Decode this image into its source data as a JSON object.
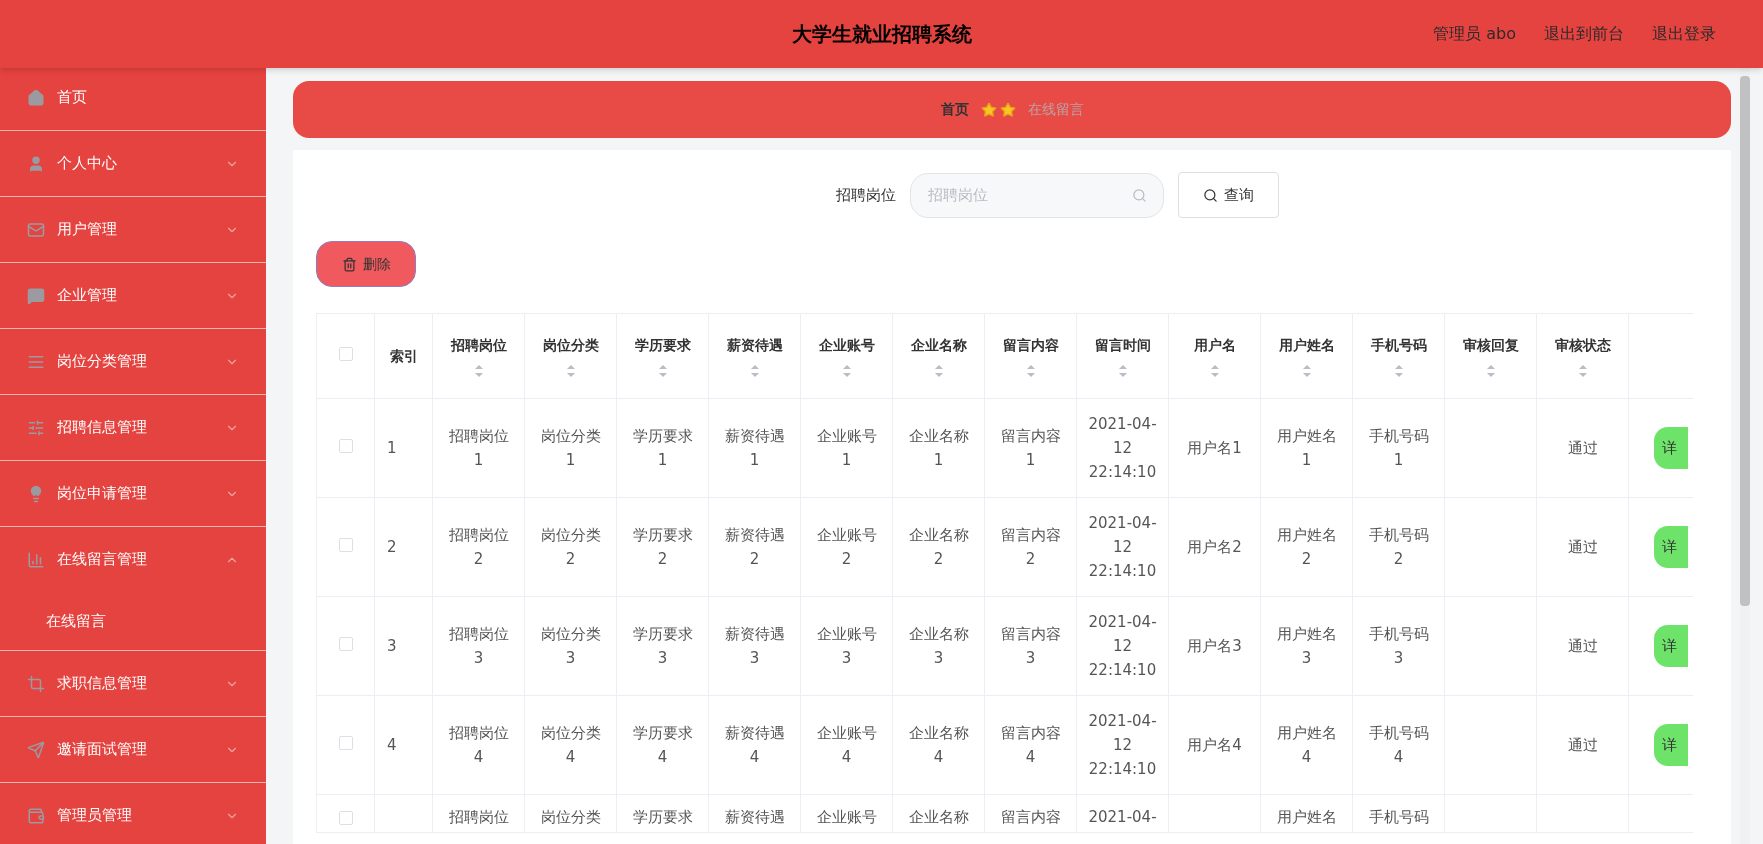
{
  "header": {
    "title": "大学生就业招聘系统",
    "links": [
      "管理员 abo",
      "退出到前台",
      "退出登录"
    ]
  },
  "sidebar": {
    "items": [
      {
        "label": "首页",
        "kind": "link"
      },
      {
        "label": "个人中心",
        "kind": "menu",
        "expanded": false
      },
      {
        "label": "用户管理",
        "kind": "menu",
        "expanded": false
      },
      {
        "label": "企业管理",
        "kind": "menu",
        "expanded": false
      },
      {
        "label": "岗位分类管理",
        "kind": "menu",
        "expanded": false
      },
      {
        "label": "招聘信息管理",
        "kind": "menu",
        "expanded": false
      },
      {
        "label": "岗位申请管理",
        "kind": "menu",
        "expanded": false
      },
      {
        "label": "在线留言管理",
        "kind": "menu",
        "expanded": true,
        "children": [
          {
            "label": "在线留言"
          }
        ]
      },
      {
        "label": "求职信息管理",
        "kind": "menu",
        "expanded": false
      },
      {
        "label": "邀请面试管理",
        "kind": "menu",
        "expanded": false
      },
      {
        "label": "管理员管理",
        "kind": "menu",
        "expanded": false
      }
    ]
  },
  "breadcrumb": {
    "home": "首页",
    "current": "在线留言"
  },
  "search": {
    "label": "招聘岗位",
    "placeholder": "招聘岗位",
    "button": "查询"
  },
  "delete_button": "删除",
  "table": {
    "all_checked": false,
    "columns": [
      "索引",
      "招聘岗位",
      "岗位分类",
      "学历要求",
      "薪资待遇",
      "企业账号",
      "企业名称",
      "留言内容",
      "留言时间",
      "用户名",
      "用户姓名",
      "手机号码",
      "审核回复",
      "审核状态"
    ],
    "rows": [
      {
        "checked": false,
        "cells": [
          "1",
          "招聘岗位1",
          "岗位分类1",
          "学历要求1",
          "薪资待遇1",
          "企业账号1",
          "企业名称1",
          "留言内容1",
          "2021-04-12 22:14:10",
          "用户名1",
          "用户姓名1",
          "手机号码1",
          "",
          "通过"
        ],
        "action": "详"
      },
      {
        "checked": false,
        "cells": [
          "2",
          "招聘岗位2",
          "岗位分类2",
          "学历要求2",
          "薪资待遇2",
          "企业账号2",
          "企业名称2",
          "留言内容2",
          "2021-04-12 22:14:10",
          "用户名2",
          "用户姓名2",
          "手机号码2",
          "",
          "通过"
        ],
        "action": "详"
      },
      {
        "checked": false,
        "cells": [
          "3",
          "招聘岗位3",
          "岗位分类3",
          "学历要求3",
          "薪资待遇3",
          "企业账号3",
          "企业名称3",
          "留言内容3",
          "2021-04-12 22:14:10",
          "用户名3",
          "用户姓名3",
          "手机号码3",
          "",
          "通过"
        ],
        "action": "详"
      },
      {
        "checked": false,
        "cells": [
          "4",
          "招聘岗位4",
          "岗位分类4",
          "学历要求4",
          "薪资待遇4",
          "企业账号4",
          "企业名称4",
          "留言内容4",
          "2021-04-12 22:14:10",
          "用户名4",
          "用户姓名4",
          "手机号码4",
          "",
          "通过"
        ],
        "action": "详"
      },
      {
        "checked": false,
        "cells": [
          "",
          "招聘岗位",
          "岗位分类",
          "学历要求",
          "薪资待遇",
          "企业账号",
          "企业名称",
          "留言内容",
          "2021-04-",
          "",
          "用户姓名",
          "手机号码",
          "",
          ""
        ],
        "action": ""
      }
    ]
  }
}
